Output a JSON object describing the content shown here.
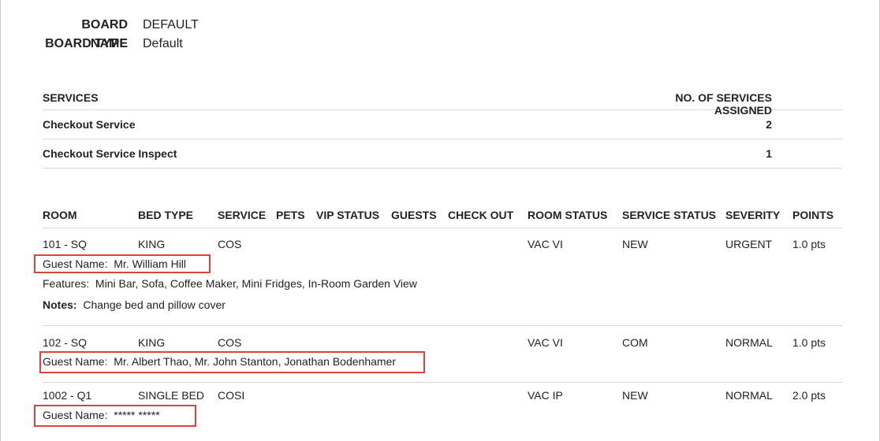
{
  "board": {
    "name_label": "BOARD NAME",
    "name_value": "DEFAULT",
    "type_label": "BOARD TYPE",
    "type_value": "Default"
  },
  "services": {
    "headers": {
      "service": "SERVICES",
      "count": "NO. OF SERVICES ASSIGNED"
    },
    "rows": [
      {
        "name": "Checkout Service",
        "count": "2"
      },
      {
        "name": "Checkout Service Inspect",
        "count": "1"
      }
    ]
  },
  "rooms": {
    "headers": {
      "room": "ROOM",
      "bed_type": "BED TYPE",
      "service": "SERVICE",
      "pets": "PETS",
      "vip_status": "VIP STATUS",
      "guests": "GUESTS",
      "check_out": "CHECK OUT",
      "room_status": "ROOM STATUS",
      "service_status": "SERVICE STATUS",
      "severity": "SEVERITY",
      "points": "POINTS"
    },
    "rows": [
      {
        "room": "101 - SQ",
        "bed_type": "KING",
        "service": "COS",
        "room_status": "VAC VI",
        "service_status": "NEW",
        "severity": "URGENT",
        "points": "1.0 pts",
        "guest_label": "Guest Name:",
        "guest_value": "Mr. William Hill",
        "features_label": "Features:",
        "features_value": "Mini Bar, Sofa, Coffee Maker, Mini Fridges, In-Room Garden View",
        "notes_label": "Notes:",
        "notes_value": "Change bed and pillow cover"
      },
      {
        "room": "102 - SQ",
        "bed_type": "KING",
        "service": "COS",
        "room_status": "VAC VI",
        "service_status": "COM",
        "severity": "NORMAL",
        "points": "1.0 pts",
        "guest_label": "Guest Name:",
        "guest_value": "Mr. Albert Thao, Mr. John Stanton, Jonathan Bodenhamer"
      },
      {
        "room": "1002 - Q1",
        "bed_type": "SINGLE BED",
        "service": "COSI",
        "room_status": "VAC IP",
        "service_status": "NEW",
        "severity": "NORMAL",
        "points": "2.0 pts",
        "guest_label": "Guest Name:",
        "guest_value": "***** *****"
      }
    ]
  },
  "colors": {
    "highlight_border": "#d9453d",
    "divider": "#d9d9d9"
  }
}
